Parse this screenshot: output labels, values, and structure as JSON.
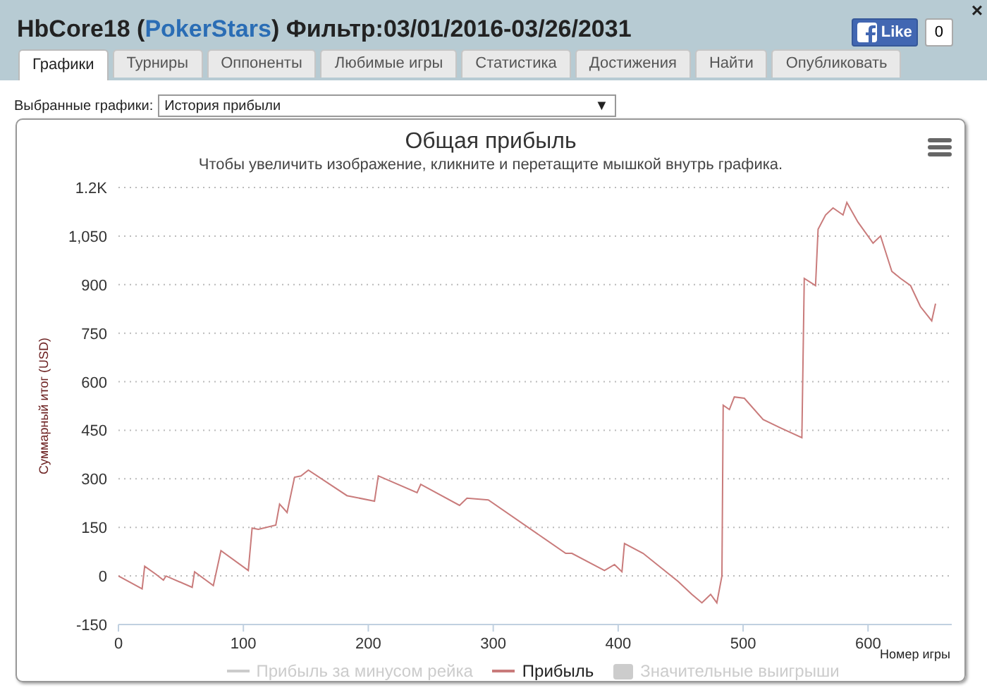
{
  "header": {
    "title_before": "HbCore18 (",
    "site": "PokerStars",
    "title_after": ") Фильтр:03/01/2016-03/26/2031",
    "like_label": "Like",
    "like_count": "0",
    "close": "×"
  },
  "tabs": [
    {
      "label": "Графики",
      "selected": true
    },
    {
      "label": "Турниры",
      "selected": false
    },
    {
      "label": "Оппоненты",
      "selected": false
    },
    {
      "label": "Любимые игры",
      "selected": false
    },
    {
      "label": "Статистика",
      "selected": false
    },
    {
      "label": "Достижения",
      "selected": false
    },
    {
      "label": "Найти",
      "selected": false
    },
    {
      "label": "Опубликовать",
      "selected": false
    }
  ],
  "selector": {
    "label": "Выбранные графики:",
    "value": "История прибыли",
    "arrow": "▼"
  },
  "chart": {
    "title": "Общая прибыль",
    "subtitle": "Чтобы увеличить изображение, кликните и перетащите мышкой внутрь графика.",
    "legend": [
      {
        "label": "Прибыль за минусом рейка",
        "kind": "line",
        "enabled": false,
        "color": "#cccccc"
      },
      {
        "kind": "series",
        "enabled": true
      },
      {
        "label": "Значительные выигрыши",
        "kind": "area",
        "enabled": false,
        "color": "#cccccc"
      }
    ],
    "chart_data": {
      "type": "line",
      "grid": true,
      "xlabel": "Номер игры",
      "ylabel": "Суммарный итог (USD)",
      "xlim": [
        0,
        667
      ],
      "ylim": [
        -150,
        1200
      ],
      "xticks": [
        0,
        100,
        200,
        300,
        400,
        500,
        600
      ],
      "yticks": [
        {
          "value": -150,
          "label": "-150"
        },
        {
          "value": 0,
          "label": "0"
        },
        {
          "value": 150,
          "label": "150"
        },
        {
          "value": 300,
          "label": "300"
        },
        {
          "value": 450,
          "label": "450"
        },
        {
          "value": 600,
          "label": "600"
        },
        {
          "value": 750,
          "label": "750"
        },
        {
          "value": 900,
          "label": "900"
        },
        {
          "value": 1050,
          "label": "1,050"
        },
        {
          "value": 1200,
          "label": "1.2K"
        }
      ],
      "x": [
        0,
        19,
        21,
        30,
        36,
        38,
        59,
        61,
        76,
        82,
        104,
        107,
        112,
        126,
        129,
        135,
        141,
        146,
        152,
        183,
        205,
        208,
        239,
        242,
        273,
        279,
        296,
        358,
        363,
        389,
        397,
        403,
        405,
        420,
        448,
        459,
        467,
        474,
        479,
        483,
        484,
        489,
        493,
        501,
        516,
        530,
        547,
        549,
        558,
        560,
        566,
        572,
        580,
        583,
        592,
        604,
        610,
        619,
        626,
        634,
        642,
        651,
        654
      ],
      "series": [
        {
          "name": "Прибыль",
          "color": "#c97b7b",
          "values": [
            0,
            -40,
            30,
            5,
            -13,
            0,
            -35,
            13,
            -30,
            78,
            17,
            148,
            144,
            157,
            222,
            196,
            305,
            309,
            327,
            248,
            231,
            309,
            257,
            283,
            218,
            240,
            235,
            70,
            70,
            17,
            35,
            13,
            100,
            70,
            -17,
            -57,
            -83,
            -57,
            -83,
            0,
            527,
            514,
            553,
            549,
            483,
            457,
            427,
            919,
            897,
            1071,
            1115,
            1137,
            1115,
            1154,
            1093,
            1028,
            1050,
            941,
            919,
            897,
            832,
            788,
            841
          ]
        }
      ]
    }
  }
}
